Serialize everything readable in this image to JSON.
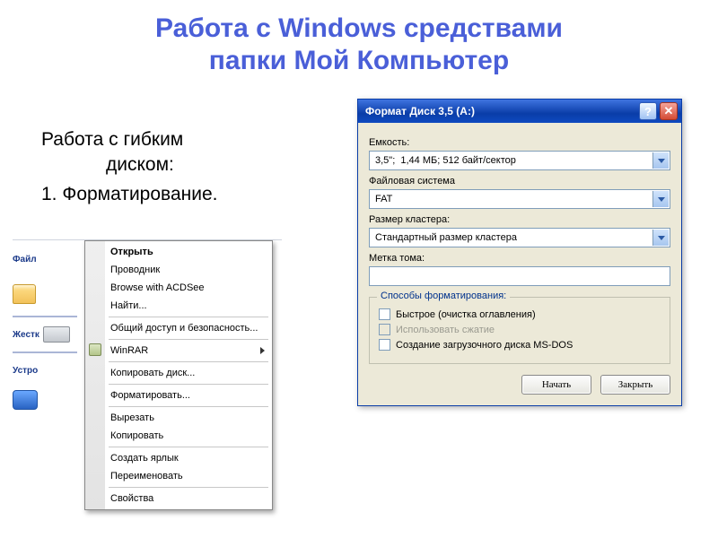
{
  "slide": {
    "title_line1": "Работа с Windows средствами",
    "title_line2": "папки Мой Компьютер"
  },
  "left": {
    "heading_l1": "Работа с гибким",
    "heading_l2": "диском:",
    "item1": "1.   Форматирование."
  },
  "sidebar": {
    "label_file": "Файл",
    "label_hard": "Жестк",
    "label_dev": "Устро"
  },
  "context_menu": {
    "items": [
      "Открыть",
      "Проводник",
      "Browse with ACDSee",
      "Найти...",
      "Общий доступ и безопасность...",
      "WinRAR",
      "Копировать диск...",
      "Форматировать...",
      "Вырезать",
      "Копировать",
      "Создать ярлык",
      "Переименовать",
      "Свойства"
    ]
  },
  "dialog": {
    "title": "Формат Диск 3,5 (A:)",
    "labels": {
      "capacity": "Емкость:",
      "filesystem": "Файловая система",
      "cluster": "Размер кластера:",
      "volume": "Метка тома:",
      "options": "Способы форматирования:"
    },
    "fields": {
      "capacity": "3,5\";  1,44 МБ; 512 байт/сектор",
      "filesystem": "FAT",
      "cluster": "Стандартный размер кластера",
      "volume": ""
    },
    "options": {
      "quick": "Быстрое (очистка оглавления)",
      "compress": "Использовать сжатие",
      "msdos": "Создание загрузочного диска MS-DOS"
    },
    "buttons": {
      "start": "Начать",
      "close": "Закрыть"
    },
    "titlebar": {
      "help": "?",
      "close": "✕"
    }
  }
}
